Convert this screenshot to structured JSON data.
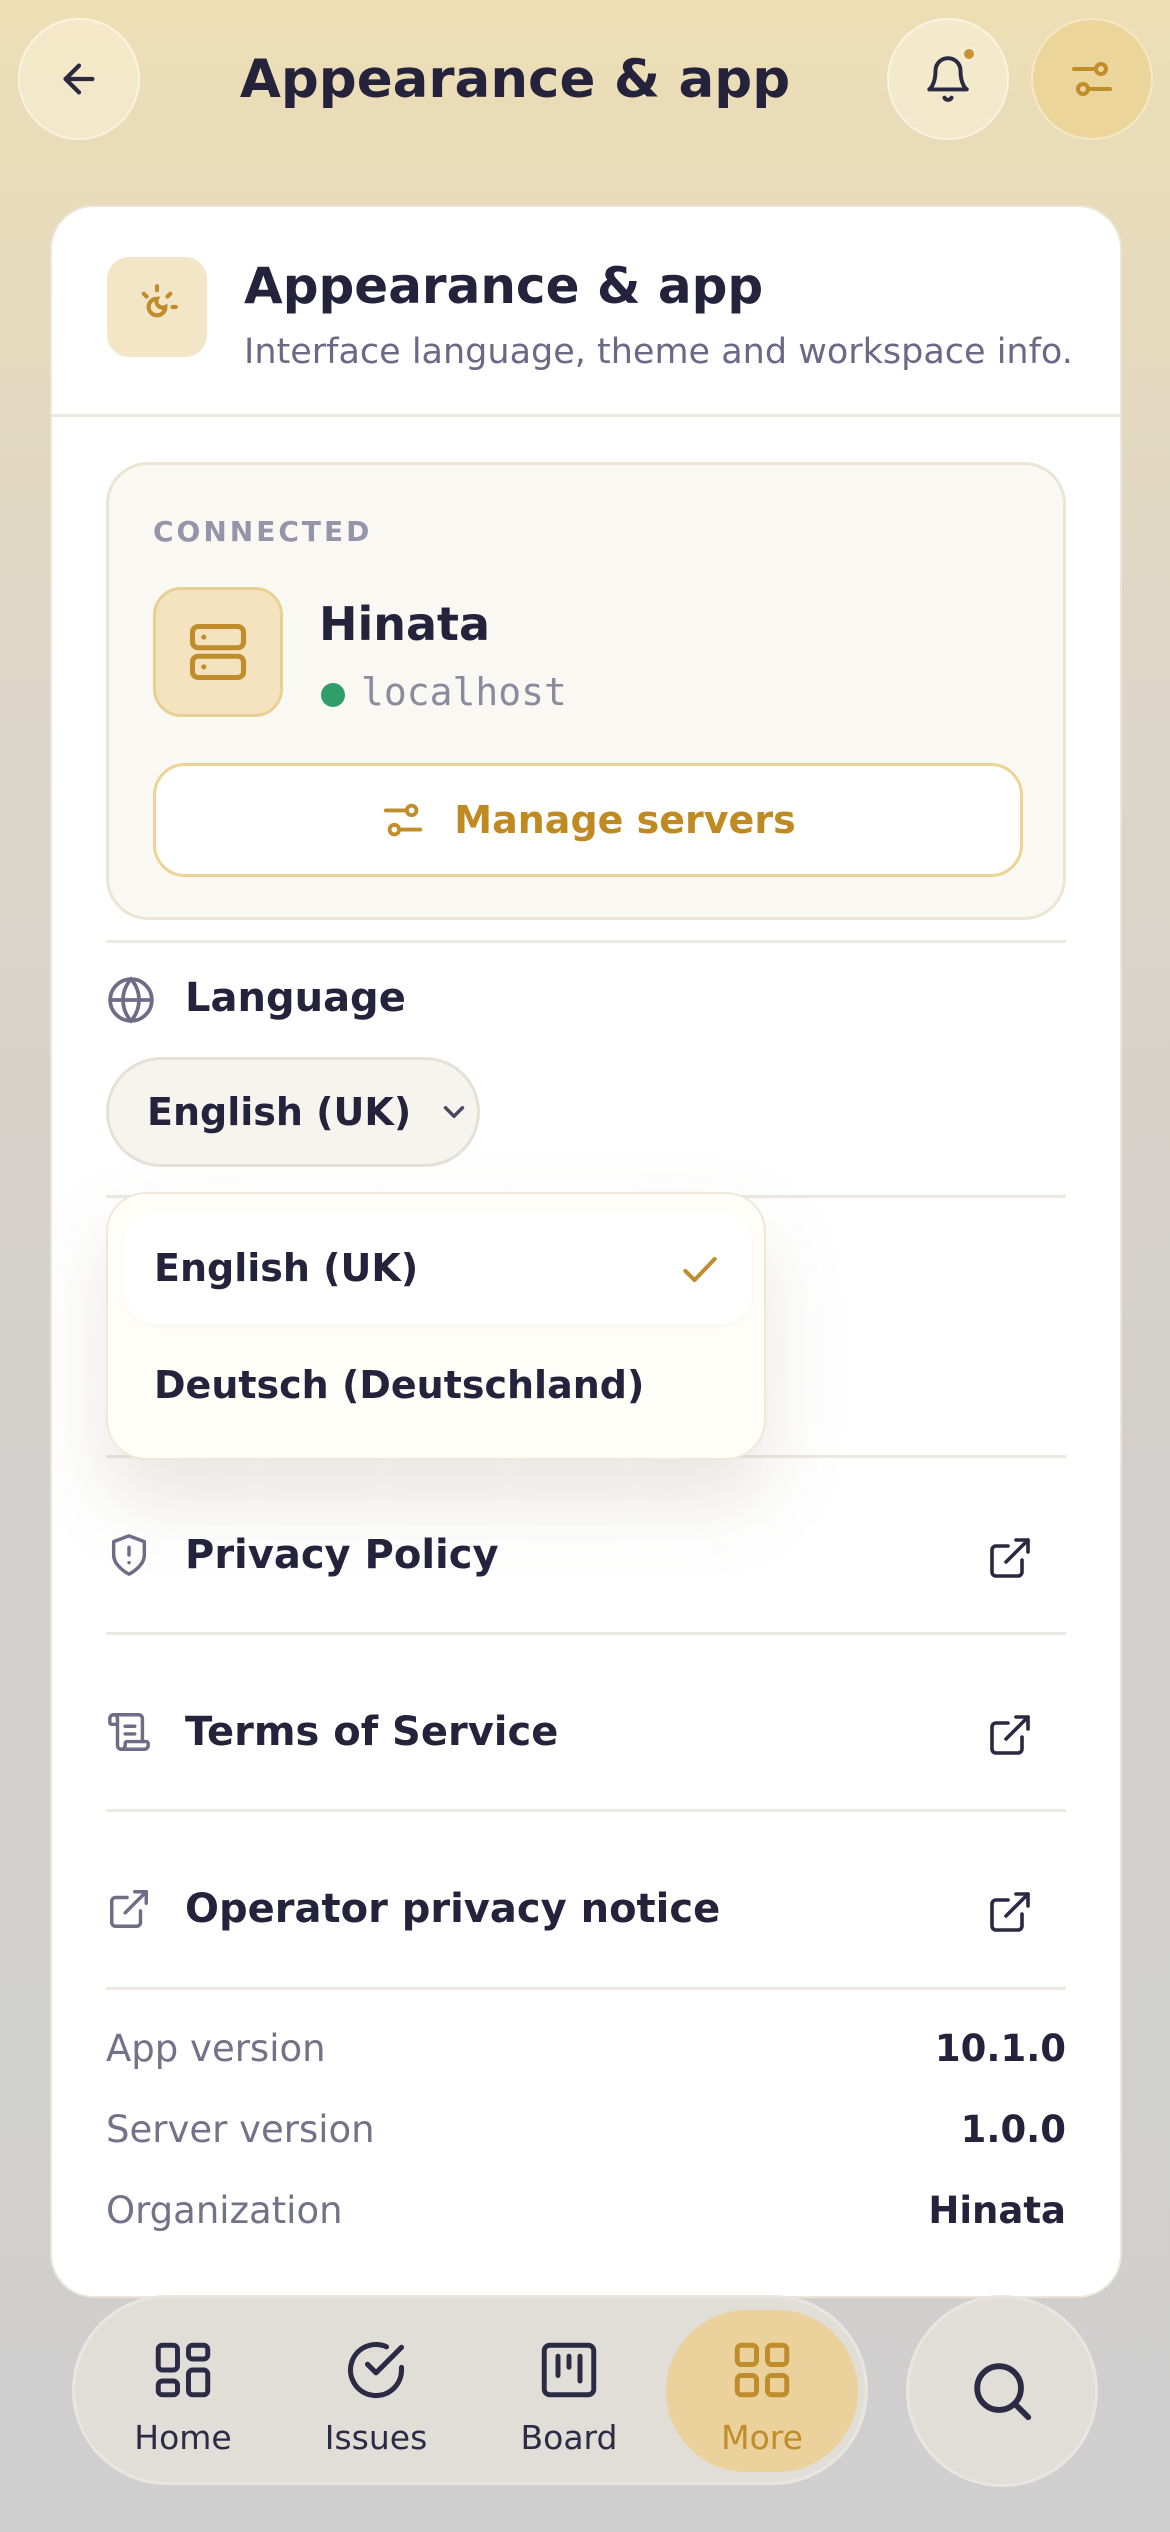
{
  "header": {
    "title": "Appearance & app",
    "back_icon": "arrow-left-icon",
    "notification_icon": "bell-icon",
    "filter_icon": "sliders-icon"
  },
  "card": {
    "title": "Appearance & app",
    "subtitle": "Interface language, theme and workspace info.",
    "icon": "sun-moon-icon"
  },
  "connection": {
    "label": "CONNECTED",
    "server_name": "Hinata",
    "host": "localhost",
    "status_color": "#2f9e6a",
    "manage_label": "Manage servers"
  },
  "language": {
    "label": "Language",
    "selected": "English (UK)",
    "options": [
      {
        "label": "English (UK)",
        "selected": true
      },
      {
        "label": "Deutsch (Deutschland)",
        "selected": false
      }
    ]
  },
  "links": [
    {
      "label": "Privacy Policy",
      "icon": "shield-alert-icon"
    },
    {
      "label": "Terms of Service",
      "icon": "scroll-icon"
    },
    {
      "label": "Operator privacy notice",
      "icon": "external-link-icon"
    }
  ],
  "info": [
    {
      "key": "App version",
      "value": "10.1.0"
    },
    {
      "key": "Server version",
      "value": "1.0.0"
    },
    {
      "key": "Organization",
      "value": "Hinata"
    }
  ],
  "tabs": [
    {
      "label": "Home",
      "icon": "grid-layout-icon",
      "active": false
    },
    {
      "label": "Issues",
      "icon": "check-circle-icon",
      "active": false
    },
    {
      "label": "Board",
      "icon": "kanban-icon",
      "active": false
    },
    {
      "label": "More",
      "icon": "grid-four-icon",
      "active": true
    }
  ],
  "colors": {
    "accent": "#c08d2c",
    "text": "#25233c",
    "muted": "#727289"
  }
}
